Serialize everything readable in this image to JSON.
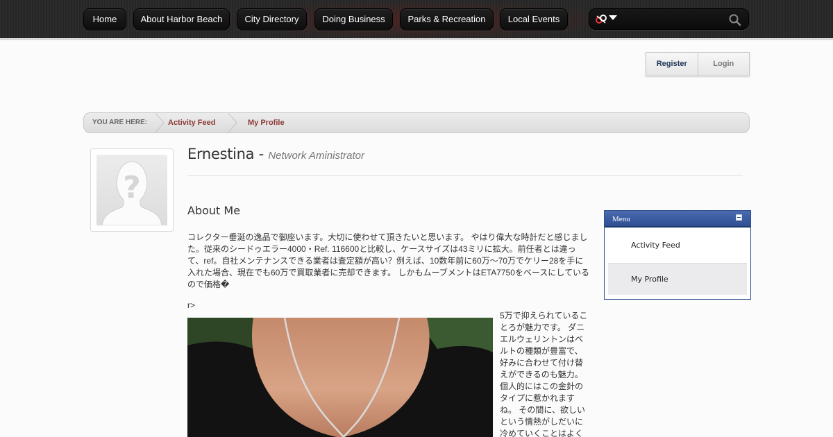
{
  "nav": {
    "items": [
      "Home",
      "About Harbor Beach",
      "City Directory",
      "Doing Business",
      "Parks & Recreation",
      "Local Events"
    ],
    "search": {
      "value": "",
      "placeholder": ""
    }
  },
  "auth": {
    "register": "Register",
    "login": "Login"
  },
  "breadcrumb": {
    "label": "YOU ARE HERE:",
    "items": [
      "Activity Feed",
      "My Profile"
    ]
  },
  "profile": {
    "name": "Ernestina",
    "separator": "-",
    "title": "Network Aministrator"
  },
  "about": {
    "heading": "About Me",
    "text": "コレクター垂涎の逸品で御座います。大切に使わせて頂きたいと思います。 やはり偉大な時計だと感じました。従来のシードゥエラー4000・Ref. 116600と比較し、ケースサイズは43ミリに拡大。前任者とは違って、ref。自社メンテナンスできる業者は査定額が高い？例えば、10数年前に60万～70万でケリー28を手に入れた場合、現在でも60万で買取業者に売却できます。 しかもムーブメントはETA7750をベースにしているので価格�",
    "stray": "r>",
    "side_text": "5万で抑えられていることろが魅力です。 ダニエルウェリントンはベルトの種類が豊富で、好みに合わせて付け替えができるのも魅力。 個人的にはこの金針のタイプに惹かれますね。 その間に、欲しいという情熱がしだいに冷めていくことはよく"
  },
  "menu": {
    "title": "Menu",
    "items": [
      "Activity Feed",
      "My Profile"
    ],
    "active": "My Profile"
  },
  "colors": {
    "breadcrumb_link": "#8b3a36",
    "menu_header": "#3a5ba0",
    "register": "#1d3557"
  }
}
